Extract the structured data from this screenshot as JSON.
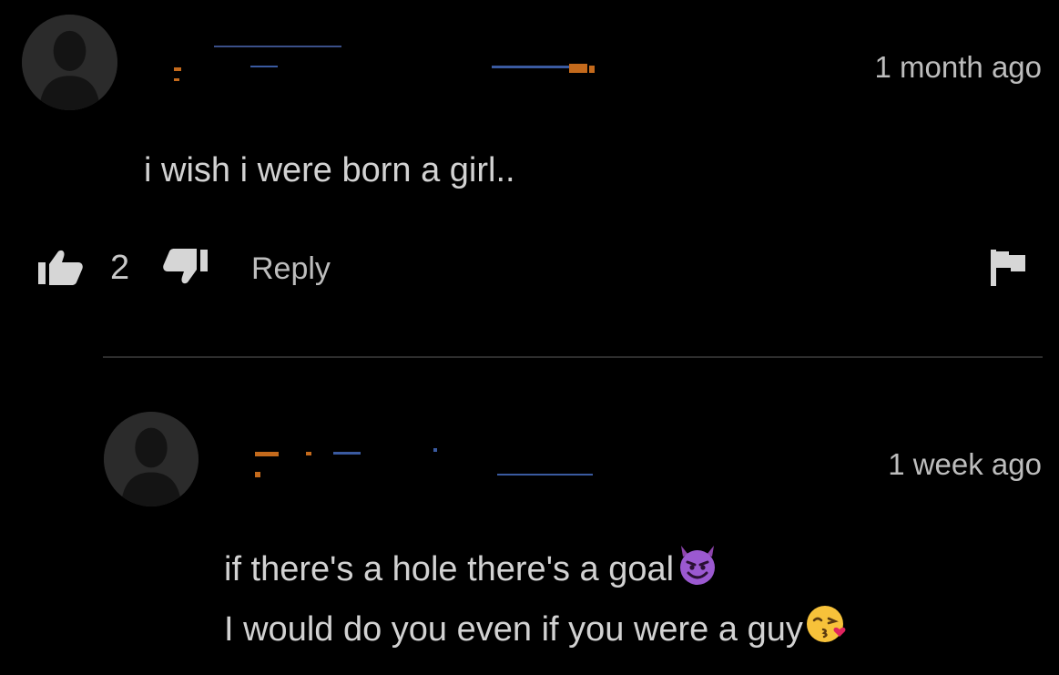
{
  "comments": [
    {
      "time": "1 month ago",
      "text": "i wish i were born a girl..",
      "likes": "2",
      "reply_label": "Reply"
    },
    {
      "time": "1 week ago",
      "lines": [
        "if there's a hole there's a goal",
        "I would do you even if you were a guy"
      ],
      "emojis": [
        "smiling-devil-emoji",
        "kissing-face-emoji"
      ]
    }
  ],
  "colors": {
    "background": "#000000",
    "text": "#d2d2d2",
    "muted": "#bdbdbd",
    "avatar": "#2b2b2b",
    "redacted_orange": "#c46a1c",
    "redacted_blue": "#3a5aa0"
  }
}
